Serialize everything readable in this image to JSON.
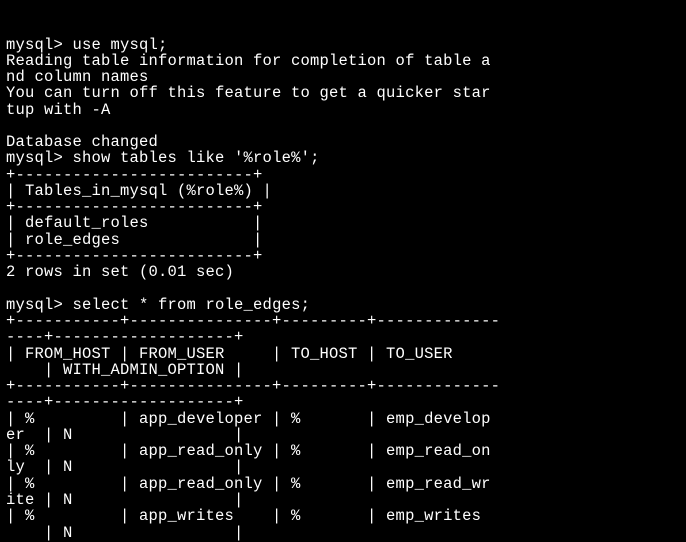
{
  "prompt": "mysql>",
  "cmd1": "use mysql;",
  "msg1_line1": "Reading table information for completion of table a",
  "msg1_line2": "nd column names",
  "msg1_line3": "You can turn off this feature to get a quicker star",
  "msg1_line4": "tup with -A",
  "msg2": "Database changed",
  "cmd2": "show tables like '%role%';",
  "border1_top": "+-------------------------+",
  "header1": "| Tables_in_mysql (%role%) |",
  "border1_mid": "+-------------------------+",
  "row1a": "| default_roles           |",
  "row1b": "| role_edges              |",
  "border1_bot": "+-------------------------+",
  "result1": "2 rows in set (0.01 sec)",
  "cmd3": "select * from role_edges;",
  "b2_top1": "+-----------+---------------+---------+-------------",
  "b2_top2": "----+-------------------+",
  "h2_line1": "| FROM_HOST | FROM_USER     | TO_HOST | TO_USER     ",
  "h2_line2": "    | WITH_ADMIN_OPTION |",
  "b2_mid1": "+-----------+---------------+---------+-------------",
  "b2_mid2": "----+-------------------+",
  "r2a1": "| %         | app_developer | %       | emp_develop",
  "r2a2": "er  | N                 |",
  "r2b1": "| %         | app_read_only | %       | emp_read_on",
  "r2b2": "ly  | N                 |",
  "r2c1": "| %         | app_read_only | %       | emp_read_wr",
  "r2c2": "ite | N                 |",
  "r2d1": "| %         | app_writes    | %       | emp_writes ",
  "r2d2": "    | N                 |",
  "chart_data": {
    "type": "table",
    "tables": [
      {
        "title": "Tables_in_mysql (%role%)",
        "columns": [
          "Tables_in_mysql (%role%)"
        ],
        "rows": [
          [
            "default_roles"
          ],
          [
            "role_edges"
          ]
        ],
        "footer": "2 rows in set (0.01 sec)"
      },
      {
        "title": "role_edges",
        "columns": [
          "FROM_HOST",
          "FROM_USER",
          "TO_HOST",
          "TO_USER",
          "WITH_ADMIN_OPTION"
        ],
        "rows": [
          [
            "%",
            "app_developer",
            "%",
            "emp_developer",
            "N"
          ],
          [
            "%",
            "app_read_only",
            "%",
            "emp_read_only",
            "N"
          ],
          [
            "%",
            "app_read_only",
            "%",
            "emp_read_write",
            "N"
          ],
          [
            "%",
            "app_writes",
            "%",
            "emp_writes",
            "N"
          ]
        ]
      }
    ]
  }
}
